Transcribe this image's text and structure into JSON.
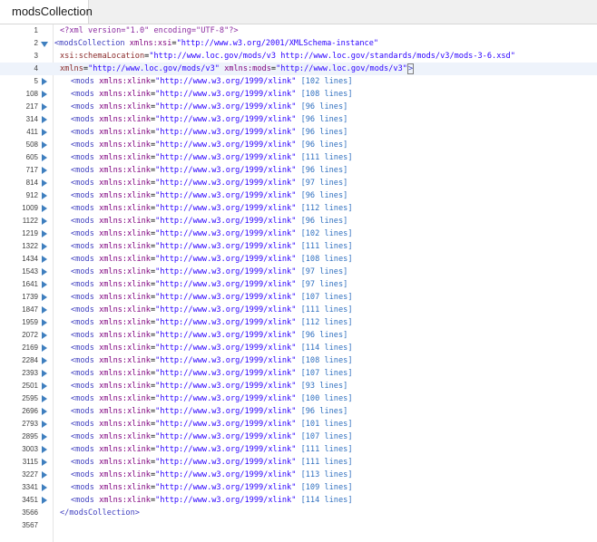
{
  "tab": {
    "title": "modsCollection"
  },
  "header_lines": {
    "decl": {
      "num": "1",
      "text": "<?xml version=\"1.0\" encoding=\"UTF-8\"?>"
    },
    "root_open": {
      "num": "2",
      "tag": "<modsCollection",
      "attr": "xmlns:xsi",
      "eq": "=",
      "value": "\"http://www.w3.org/2001/XMLSchema-instance\""
    },
    "schema": {
      "num": "3",
      "attr": "xsi:schemaLocation",
      "eq": "=",
      "value": "\"http://www.loc.gov/mods/v3 http://www.loc.gov/standards/mods/v3/mods-3-6.xsd\""
    },
    "xmlns": {
      "num": "4",
      "attr1": "xmlns",
      "eq1": "=",
      "value1": "\"http://www.loc.gov/mods/v3\"",
      "attr2": "xmlns:mods",
      "eq2": "=",
      "value2": "\"http://www.loc.gov/mods/v3\"",
      "close": ">"
    }
  },
  "mods_entry": {
    "tag": "<mods",
    "attr": "xmlns:xlink",
    "eq": "=",
    "value": "\"http://www.w3.org/1999/xlink\""
  },
  "mods_lines": [
    {
      "num": "5",
      "lines": "[102 lines]"
    },
    {
      "num": "108",
      "lines": "[108 lines]"
    },
    {
      "num": "217",
      "lines": "[96 lines]"
    },
    {
      "num": "314",
      "lines": "[96 lines]"
    },
    {
      "num": "411",
      "lines": "[96 lines]"
    },
    {
      "num": "508",
      "lines": "[96 lines]"
    },
    {
      "num": "605",
      "lines": "[111 lines]"
    },
    {
      "num": "717",
      "lines": "[96 lines]"
    },
    {
      "num": "814",
      "lines": "[97 lines]"
    },
    {
      "num": "912",
      "lines": "[96 lines]"
    },
    {
      "num": "1009",
      "lines": "[112 lines]"
    },
    {
      "num": "1122",
      "lines": "[96 lines]"
    },
    {
      "num": "1219",
      "lines": "[102 lines]"
    },
    {
      "num": "1322",
      "lines": "[111 lines]"
    },
    {
      "num": "1434",
      "lines": "[108 lines]"
    },
    {
      "num": "1543",
      "lines": "[97 lines]"
    },
    {
      "num": "1641",
      "lines": "[97 lines]"
    },
    {
      "num": "1739",
      "lines": "[107 lines]"
    },
    {
      "num": "1847",
      "lines": "[111 lines]"
    },
    {
      "num": "1959",
      "lines": "[112 lines]"
    },
    {
      "num": "2072",
      "lines": "[96 lines]"
    },
    {
      "num": "2169",
      "lines": "[114 lines]"
    },
    {
      "num": "2284",
      "lines": "[108 lines]"
    },
    {
      "num": "2393",
      "lines": "[107 lines]"
    },
    {
      "num": "2501",
      "lines": "[93 lines]"
    },
    {
      "num": "2595",
      "lines": "[100 lines]"
    },
    {
      "num": "2696",
      "lines": "[96 lines]"
    },
    {
      "num": "2793",
      "lines": "[101 lines]"
    },
    {
      "num": "2895",
      "lines": "[107 lines]"
    },
    {
      "num": "3003",
      "lines": "[111 lines]"
    },
    {
      "num": "3115",
      "lines": "[111 lines]"
    },
    {
      "num": "3227",
      "lines": "[113 lines]"
    },
    {
      "num": "3341",
      "lines": "[109 lines]"
    },
    {
      "num": "3451",
      "lines": "[114 lines]"
    }
  ],
  "footer_lines": {
    "root_close": {
      "num": "3566",
      "text": "</modsCollection>"
    },
    "empty": {
      "num": "3567"
    }
  }
}
